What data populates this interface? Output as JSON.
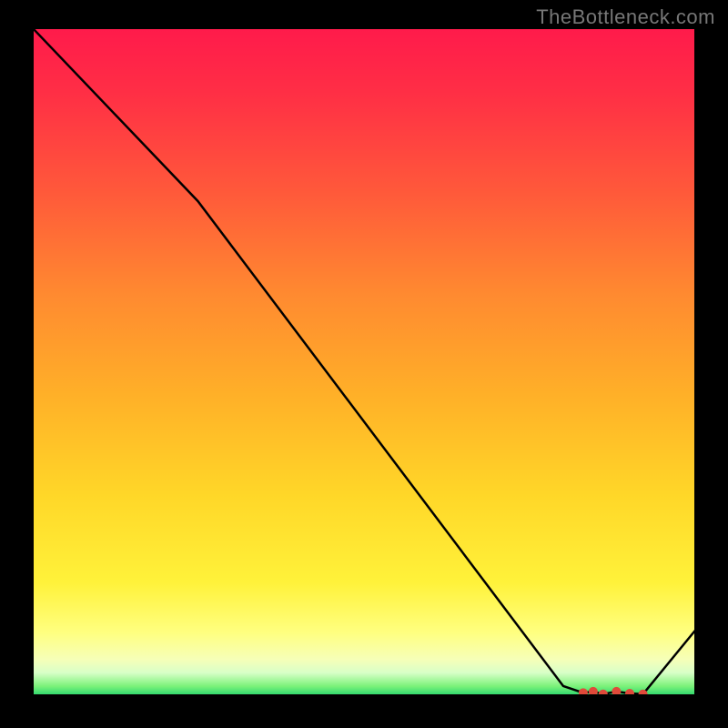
{
  "watermark": "TheBottleneck.com",
  "chart_data": {
    "type": "line",
    "title": "",
    "xlabel": "",
    "ylabel": "",
    "xlim": [
      0,
      100
    ],
    "ylim": [
      0,
      100
    ],
    "x": [
      0,
      25,
      80,
      83,
      84.5,
      86,
      88,
      90,
      92,
      100
    ],
    "y": [
      100,
      74,
      1.5,
      0.5,
      0.7,
      0.3,
      0.7,
      0.4,
      0.3,
      10
    ],
    "markers": {
      "x": [
        83,
        84.5,
        86,
        88,
        90,
        92
      ],
      "y": [
        0.5,
        0.7,
        0.3,
        0.7,
        0.4,
        0.3
      ],
      "color": "#e04a3a",
      "size": 5
    },
    "gradient_stops": [
      {
        "offset": 0.0,
        "color": "#ff1a4b"
      },
      {
        "offset": 0.1,
        "color": "#ff2f45"
      },
      {
        "offset": 0.25,
        "color": "#ff5a3a"
      },
      {
        "offset": 0.4,
        "color": "#ff8a30"
      },
      {
        "offset": 0.55,
        "color": "#ffb028"
      },
      {
        "offset": 0.7,
        "color": "#ffd728"
      },
      {
        "offset": 0.83,
        "color": "#fff23a"
      },
      {
        "offset": 0.905,
        "color": "#ffff80"
      },
      {
        "offset": 0.945,
        "color": "#f6ffb8"
      },
      {
        "offset": 0.965,
        "color": "#d8ffc8"
      },
      {
        "offset": 0.985,
        "color": "#7cf27a"
      },
      {
        "offset": 1.0,
        "color": "#24d46c"
      }
    ],
    "line_color": "#000000",
    "line_width": 2.5
  }
}
